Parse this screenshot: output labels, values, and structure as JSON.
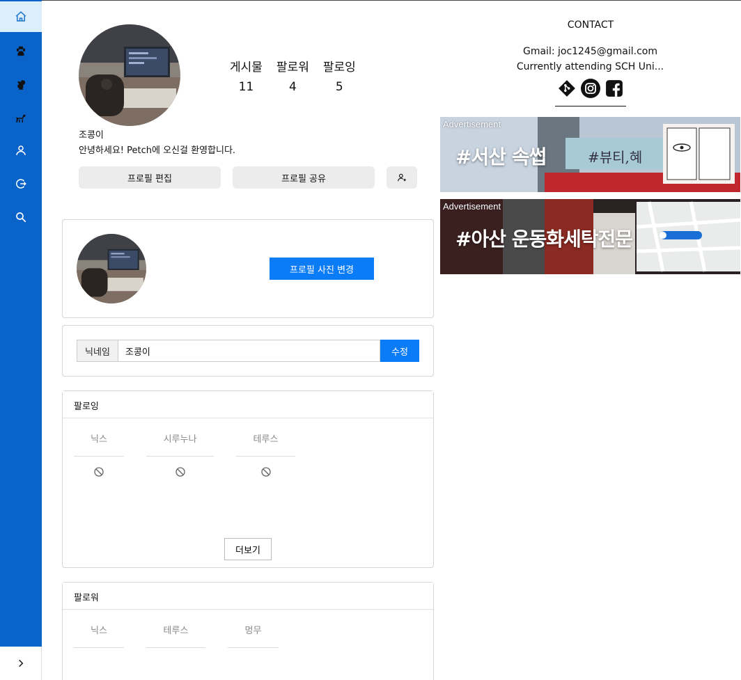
{
  "profile": {
    "stats": [
      {
        "label": "게시물",
        "value": "11"
      },
      {
        "label": "팔로워",
        "value": "4"
      },
      {
        "label": "팔로잉",
        "value": "5"
      }
    ],
    "nickname": "조콩이",
    "bio": "안녕하세요! Petch에 오신걸 환영합니다.",
    "edit_button": "프로필 편집",
    "share_button": "프로필 공유"
  },
  "photo_card": {
    "change_button": "프로필 사진 변경"
  },
  "nickname_card": {
    "label": "닉네임",
    "value": "조콩이",
    "submit": "수정"
  },
  "following": {
    "title": "팔로잉",
    "items": [
      "닉스",
      "시루누나",
      "테루스"
    ],
    "more_button": "더보기"
  },
  "followers": {
    "title": "팔로워",
    "items": [
      "닉스",
      "테루스",
      "멍무"
    ]
  },
  "contact": {
    "title": "CONTACT",
    "email": "Gmail: joc1245@gmail.com",
    "school": "Currently attending SCH Uni..."
  },
  "ads": [
    {
      "label": "Advertisement",
      "text": "#서산 속썹",
      "sign": "#뷰티,혜"
    },
    {
      "label": "Advertisement",
      "text": "#아산 운동화세탁전문"
    }
  ],
  "icons": {
    "sidebar": [
      "home-icon",
      "paw-icon",
      "squirrel-icon",
      "dog-icon",
      "user-icon",
      "logout-icon",
      "search-icon"
    ],
    "expand": "chevron-right-icon",
    "socials": [
      "git-icon",
      "instagram-icon",
      "facebook-icon"
    ]
  },
  "colors": {
    "sidebar": "#0a63c9",
    "accent": "#0a7cf7",
    "active_nav": "#dceefc"
  }
}
